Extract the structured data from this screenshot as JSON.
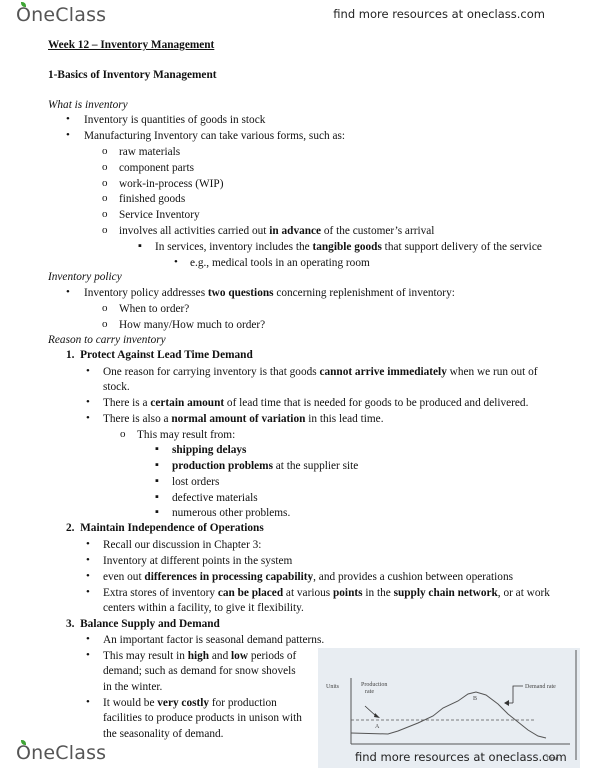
{
  "header": {
    "logo": "OneClass",
    "link": "find more resources at oneclass.com"
  },
  "footer": {
    "logo": "OneClass",
    "link": "find more resources at oneclass.com"
  },
  "doc": {
    "title": "Week 12 – Inventory Management",
    "section": "1-Basics of Inventory Management",
    "what_is": "What is inventory",
    "l1": "Inventory is quantities of goods in stock",
    "l2": "Manufacturing Inventory can take various forms, such as:",
    "f1": "raw materials",
    "f2": "component parts",
    "f3": "work-in-process (WIP)",
    "f4": "finished goods",
    "f5": "Service Inventory",
    "f6a": "involves all activities carried out ",
    "f6b": "in advance",
    "f6c": " of the customer’s arrival",
    "s1a": "In services, inventory includes the ",
    "s1b": "tangible goods",
    "s1c": " that support delivery of the service",
    "s2": "e.g., medical tools in an operating room",
    "policy": "Inventory policy",
    "p1a": "Inventory policy addresses ",
    "p1b": "two questions",
    "p1c": " concerning replenishment of inventory:",
    "q1": "When to order?",
    "q2": "How many/How much to order?",
    "reason": "Reason to carry inventory",
    "n1": "1.",
    "r1": "Protect Against Lead Time Demand",
    "r1a1": "One reason for carrying inventory is that goods ",
    "r1a2": "cannot arrive immediately",
    "r1a3": " when we run out of",
    "r1a4": "stock.",
    "r1b1": "There is a ",
    "r1b2": "certain amount",
    "r1b3": " of lead time that is needed for goods to be produced and delivered.",
    "r1c1": "There is also a ",
    "r1c2": "normal amount of variation",
    "r1c3": " in this lead time.",
    "r1d": "This may result from:",
    "c1": "shipping delays",
    "c2a": "production problems",
    "c2b": " at the supplier site",
    "c3": "lost orders",
    "c4": "defective materials",
    "c5": "numerous other problems.",
    "n2": "2.",
    "r2": "Maintain Independence of Operations",
    "r2a": "Recall our discussion in Chapter 3:",
    "r2b": "Inventory at different points in the system",
    "r2c1": "even out ",
    "r2c2": "differences in processing capability",
    "r2c3": ", and provides a cushion between operations",
    "r2d1": "Extra stores of inventory ",
    "r2d2": "can be placed",
    "r2d3": " at various ",
    "r2d4": "points",
    "r2d5": " in the ",
    "r2d6": "supply chain network",
    "r2d7": ", or at work",
    "r2d8": "centers within a facility, to give it flexibility.",
    "n3": "3.",
    "r3": "Balance Supply and Demand",
    "r3a": "An important factor is seasonal demand patterns.",
    "r3b1": "This may result in ",
    "r3b2": "high",
    "r3b3": " and ",
    "r3b4": "low",
    "r3b5": " periods of",
    "r3b6": "demand; such as demand for snow shovels",
    "r3b7": "in the winter.",
    "r3c1": "It would be ",
    "r3c2": "very costly",
    "r3c3": " for production",
    "r3c4": "facilities to produce products in unison with",
    "r3c5": "the seasonality of demand."
  },
  "figure": {
    "y_label": "Units",
    "x_label": "Time",
    "production_label_1": "Production",
    "production_label_2": "rate",
    "demand_label": "Demand rate",
    "point_a": "A",
    "point_b": "B"
  }
}
